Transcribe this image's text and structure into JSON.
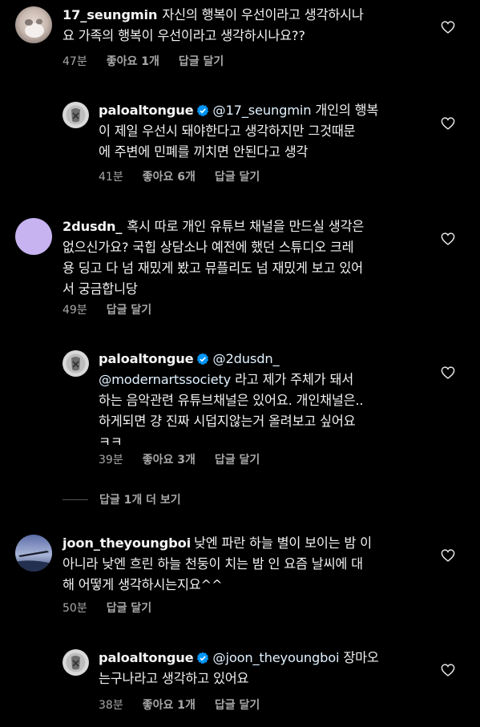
{
  "comments": [
    {
      "username": "17_seungmin",
      "lines": [
        "자신의 행복이 우선이라고 생각하시나",
        "요 가족의 행복이 우선이라고 생각하시나요??"
      ],
      "time": "47분",
      "likes": "좋아요 1개",
      "reply": "답글 달기"
    },
    {
      "username": "paloaltongue",
      "mention": "@17_seungmin",
      "lines": [
        "개인의 행복",
        "이 제일 우선시 돼야한다고 생각하지만 그것때문",
        "에 주변에 민폐를 끼치면 안된다고 생각"
      ],
      "time": "41분",
      "likes": "좋아요 6개",
      "reply": "답글 달기"
    },
    {
      "username": "2dusdn_",
      "lines": [
        "혹시 따로 개인 유튜브 채널을 만드실 생각은",
        "없으신가요? 국힙 상담소나 예전에 했던 스튜디오 크레",
        "용 딩고 다 넘 재밌게 봤고 뮤플리도 넘 재밌게 보고 있어",
        "서 궁금합니당"
      ],
      "time": "49분",
      "reply": "답글 달기"
    },
    {
      "username": "paloaltongue",
      "mention": "@2dusdn_",
      "mention2": "@modernartssociety",
      "lines": [
        "라고 제가 주체가 돼서",
        "하는 음악관련 유튜브채널은 있어요. 개인채널은..",
        "하게되면 걍 진짜 시덥지않는거 올려보고 싶어요",
        "ㅋㅋ"
      ],
      "time": "39분",
      "likes": "좋아요 3개",
      "reply": "답글 달기"
    },
    {
      "username": "joon_theyoungboi",
      "lines": [
        "낮엔 파란 하늘 별이 보이는 밤 이",
        "아니라 낮엔 흐린 하늘 천둥이 치는 밤 인 요즘 날씨에 대",
        "해 어떻게 생각하시는지요^^"
      ],
      "time": "50분",
      "reply": "답글 달기"
    },
    {
      "username": "paloaltongue",
      "mention": "@joon_theyoungboi",
      "lines": [
        "장마오",
        "는구나라고 생각하고 있어요"
      ],
      "time": "38분",
      "likes": "좋아요 1개",
      "reply": "답글 달기"
    }
  ],
  "more_replies": "답글 1개 더 보기",
  "colors": {
    "background": "#000000",
    "text": "#f2f2f2",
    "meta": "#a8a8a8",
    "verified": "#0095f6",
    "mention": "#e0f1ff"
  },
  "icons": [
    "verified-badge-icon",
    "heart-icon"
  ]
}
